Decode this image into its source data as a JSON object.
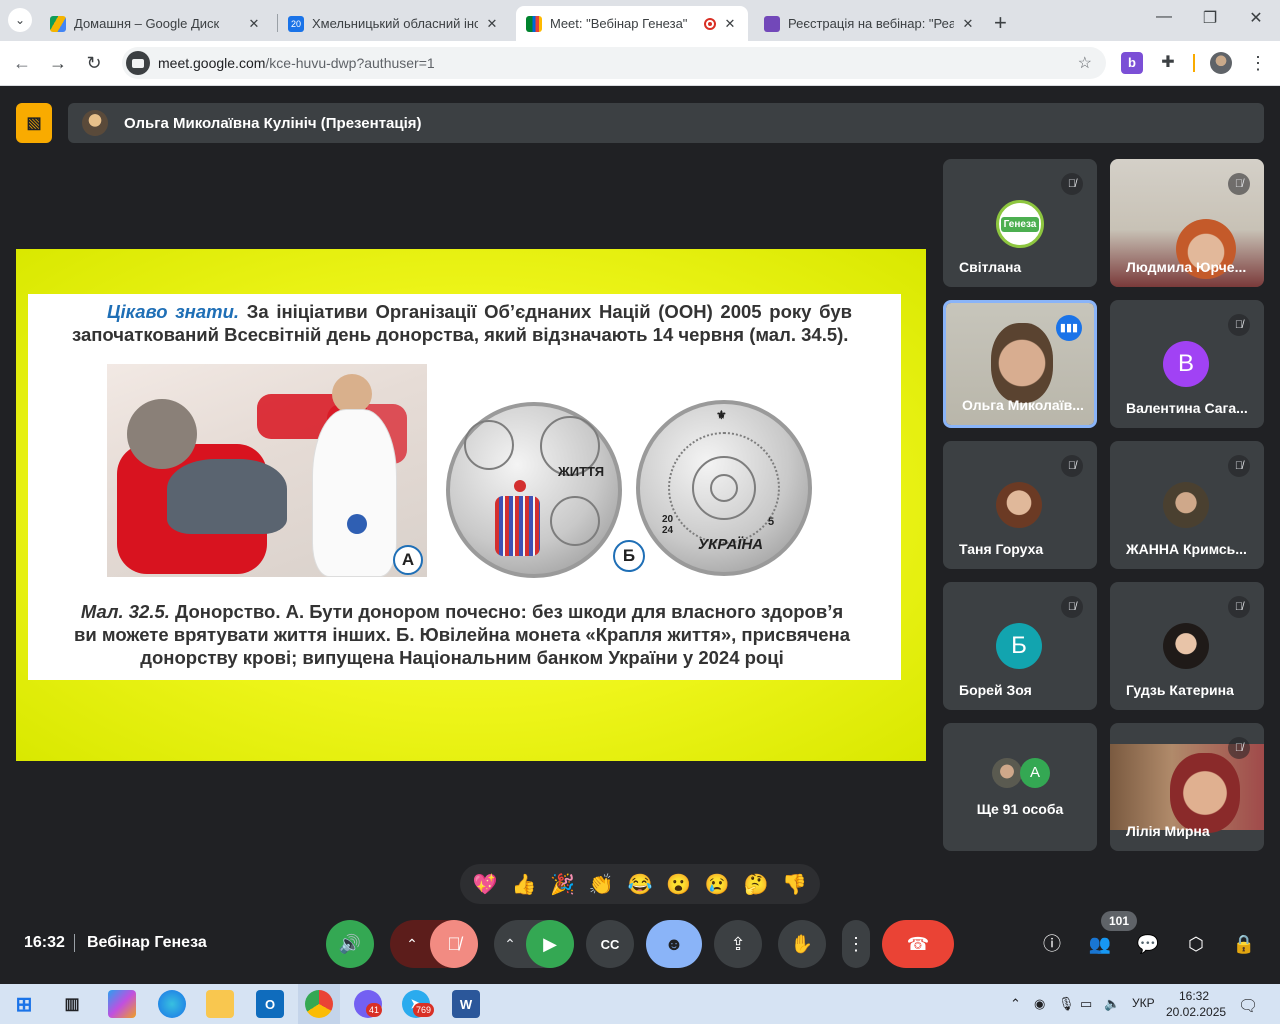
{
  "browser": {
    "tabs": [
      {
        "title": "Домашня – Google Диск",
        "favicon": "drive-icon",
        "active": false
      },
      {
        "title": "Хмельницький обласний інсти",
        "favicon": "calendar-icon",
        "active": false
      },
      {
        "title": "Meet: \"Вебінар Генеза\"",
        "favicon": "meet-icon",
        "active": true
      },
      {
        "title": "Реєстрація на вебінар: \"Реаліз",
        "favicon": "forms-icon",
        "active": false
      }
    ],
    "url_host": "meet.google.com",
    "url_path": "/kce-huvu-dwp?authuser=1",
    "tab_icon_text": "20"
  },
  "presentation": {
    "presenter": "Ольга Миколаївна Кулініч (Презентація)"
  },
  "slide": {
    "lead": "Цікаво знати.",
    "text": " За ініціативи Організації Об’єднаних Націй (ООН) 2005 року був започаткований Всесвітній день донорства, який відзначають 14 червня (мал. 34.5).",
    "label_a": "А",
    "label_b": "Б",
    "coin_word": "ЖИТТЯ",
    "coin_country": "УКРАЇНА",
    "coin_year_top": "20",
    "coin_year_bottom": "24",
    "coin_value": "5",
    "caption_lead": "Мал. 32.5.",
    "caption": " Донорство. А. Бути донором почесно: без шкоди для власного здоров’я ви можете врятувати життя інших. Б. Ювілейна монета «Крапля життя», присвячена донорству крові; випущена Національним банком України у 2024 році"
  },
  "participants": [
    {
      "name": "Світлана",
      "logo_text": "Генеза"
    },
    {
      "name": "Людмила Юрче..."
    },
    {
      "name": "Ольга Миколаїв..."
    },
    {
      "name": "Валентина Сага...",
      "initial": "В"
    },
    {
      "name": "Таня Горуха"
    },
    {
      "name": "ЖАННА Кримсь..."
    },
    {
      "name": "Борей Зоя",
      "initial": "Б"
    },
    {
      "name": "Гудзь Катерина"
    },
    {
      "name": "Ще 91 особа",
      "initial": "А"
    },
    {
      "name": "Лілія Мирна"
    }
  ],
  "reactions": [
    "💖",
    "👍",
    "🎉",
    "👏",
    "😂",
    "😮",
    "😢",
    "🤔",
    "👎"
  ],
  "bottom": {
    "time": "16:32",
    "meeting": "Вебінар Генеза",
    "participant_count": "101"
  },
  "taskbar": {
    "viber_badge": "41",
    "telegram_badge": "769",
    "lang": "УКР",
    "time": "16:32",
    "date": "20.02.2025"
  },
  "colors": {
    "accent": "#8ab4f8",
    "end_call": "#ea4335",
    "mic_off": "#f28b82",
    "camera_on": "#34a853",
    "reactions_on": "#8ab4f8"
  }
}
